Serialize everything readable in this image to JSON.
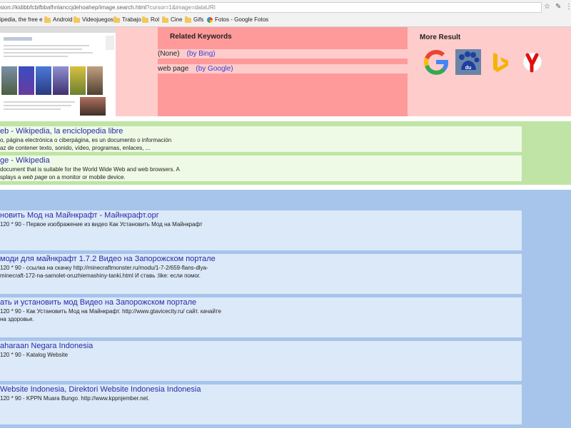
{
  "browser": {
    "url_main": "sion://kidibbfcbifbbafhnlanccjdehoahep/image.search.html",
    "url_rest": "?cursor=1&image=dataURI",
    "bookmarks": [
      "ipedia, the free e",
      "Android",
      "Videojuegos",
      "Trabajo",
      "Rol",
      "Cine",
      "Gifs",
      "Fotos - Google Fotos"
    ]
  },
  "related": {
    "title": "Related Keywords",
    "rows": [
      {
        "keyword": "(None)",
        "link": "(by Bing)"
      },
      {
        "keyword": "web page",
        "link": "(by Google)"
      }
    ]
  },
  "more": {
    "title": "More Result",
    "engines": [
      "google-icon",
      "baidu-icon",
      "bing-icon",
      "yandex-icon"
    ]
  },
  "green_results": [
    {
      "title": "eb - Wikipedia, la enciclopedia libre",
      "line1": "o, página electrónica o ciberpágina, es un documento o información",
      "line2": "az de contener texto, sonido, vídeo, programas, enlaces, ..."
    },
    {
      "title": "ge - Wikipedia",
      "line1": "document that is suitable for the World Wide Web and web browsers. A",
      "line2a": "splays a ",
      "line2b": "web page",
      "line2c": " on a monitor or mobile device."
    }
  ],
  "blue_results": [
    {
      "title": "новить Мод на Майнкрафт - Майнкрафт.орг",
      "line1": "120 * 90 - Первое изображение из видео Как Установить Мод на Майнкрафт",
      "line2": ""
    },
    {
      "title": "моди для майнкрафт 1.7.2 Видео на Запорожском портале",
      "line1": "120 * 90 - ссылка на скачку http://minecraftmonster.ru/modu/1-7-2/659-flans-dlya-",
      "line2": "minecraft-172-na-samolet-oruzhiemashiny-tanki.html И ставь :like: если помог."
    },
    {
      "title": "ать и установить мод Видео на Запорожском портале",
      "line1": "120 * 90 - Как Установить Мод на Майнкрафт. http://www.gtavicecity.ru/ сайт. качайте",
      "line2": "на здоровье."
    },
    {
      "title": "aharaan Negara Indonesia",
      "line1": "120 * 90 - Katalog Website",
      "line2": ""
    },
    {
      "title": "Website Indonesia, Direktori Website Indonesia Indonesia",
      "line1": "120 * 90 - KPPN Muara Bungo. http://www.kppnjember.net.",
      "line2": ""
    }
  ]
}
